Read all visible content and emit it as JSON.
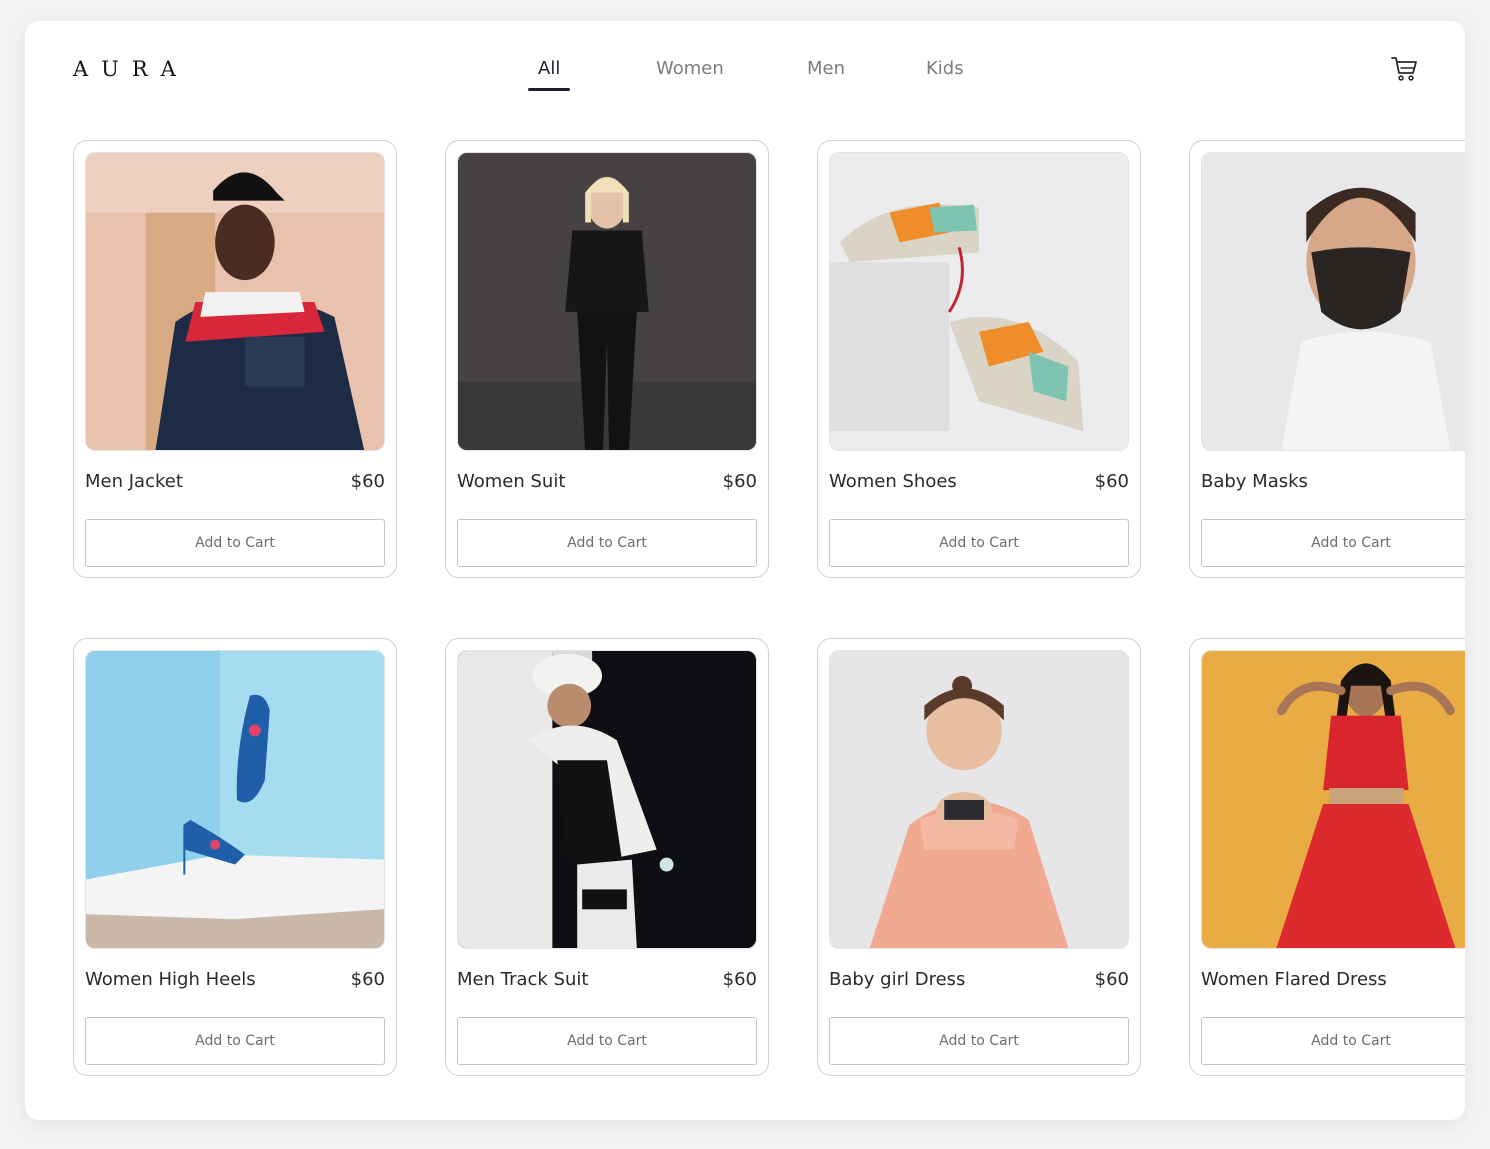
{
  "brand": {
    "logo": "AURA"
  },
  "nav": {
    "tabs": [
      "All",
      "Women",
      "Men",
      "Kids"
    ],
    "active": "All"
  },
  "header": {
    "cart_icon": "cart-icon"
  },
  "products": [
    {
      "name": "Men Jacket",
      "price": "$60",
      "button": "Add to Cart"
    },
    {
      "name": "Women Suit",
      "price": "$60",
      "button": "Add to Cart"
    },
    {
      "name": "Women Shoes",
      "price": "$60",
      "button": "Add to Cart"
    },
    {
      "name": "Baby Masks",
      "price": "",
      "button": "Add to Cart"
    },
    {
      "name": "Women High Heels",
      "price": "$60",
      "button": "Add to Cart"
    },
    {
      "name": "Men Track Suit",
      "price": "$60",
      "button": "Add to Cart"
    },
    {
      "name": "Baby girl Dress",
      "price": "$60",
      "button": "Add to Cart"
    },
    {
      "name": "Women Flared Dress",
      "price": "",
      "button": "Add to Cart"
    }
  ],
  "colors": {
    "accent": "#1d1f2e",
    "muted": "#7b7b80",
    "border": "#cfcfd3"
  }
}
